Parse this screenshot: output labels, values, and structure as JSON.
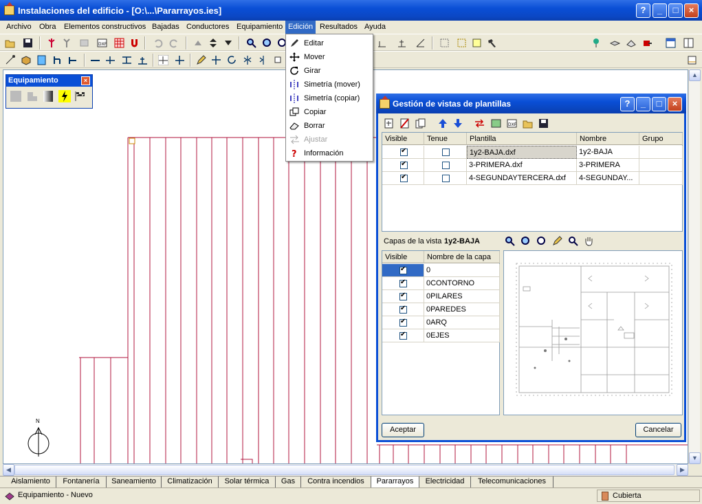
{
  "window": {
    "title": "Instalaciones del edificio - [O:\\...\\Pararrayos.ies]"
  },
  "menubar": [
    "Archivo",
    "Obra",
    "Elementos constructivos",
    "Bajadas",
    "Conductores",
    "Equipamiento",
    "Edición",
    "Resultados",
    "Ayuda"
  ],
  "edit_menu": [
    {
      "label": "Editar",
      "icon": "pencil-icon",
      "enabled": true
    },
    {
      "label": "Mover",
      "icon": "move-arrows-icon",
      "enabled": true
    },
    {
      "label": "Girar",
      "icon": "rotate-icon",
      "enabled": true
    },
    {
      "label": "Simetría (mover)",
      "icon": "mirror-move-icon",
      "enabled": true
    },
    {
      "label": "Simetría (copiar)",
      "icon": "mirror-copy-icon",
      "enabled": true
    },
    {
      "label": "Copiar",
      "icon": "copy-icon",
      "enabled": true
    },
    {
      "label": "Borrar",
      "icon": "eraser-icon",
      "enabled": true
    },
    {
      "label": "Ajustar",
      "icon": "adjust-icon",
      "enabled": false
    },
    {
      "label": "Información",
      "icon": "info-icon",
      "enabled": true
    }
  ],
  "palette": {
    "title": "Equipamiento"
  },
  "dialog": {
    "title": "Gestión de vistas de plantillas",
    "columns": [
      "Visible",
      "Tenue",
      "Plantilla",
      "Nombre",
      "Grupo"
    ],
    "rows": [
      {
        "visible": true,
        "tenue": false,
        "plantilla": "1y2-BAJA.dxf",
        "nombre": "1y2-BAJA",
        "grupo": ""
      },
      {
        "visible": true,
        "tenue": false,
        "plantilla": "3-PRIMERA.dxf",
        "nombre": "3-PRIMERA",
        "grupo": ""
      },
      {
        "visible": true,
        "tenue": false,
        "plantilla": "4-SEGUNDAYTERCERA.dxf",
        "nombre": "4-SEGUNDAY...",
        "grupo": ""
      }
    ],
    "layers_label": "Capas de la vista",
    "layers_view": "1y2-BAJA",
    "layer_columns": [
      "Visible",
      "Nombre de la capa"
    ],
    "layers": [
      {
        "visible": true,
        "name": "0"
      },
      {
        "visible": true,
        "name": "0CONTORNO"
      },
      {
        "visible": true,
        "name": "0PILARES"
      },
      {
        "visible": true,
        "name": "0PAREDES"
      },
      {
        "visible": true,
        "name": "0ARQ"
      },
      {
        "visible": true,
        "name": "0EJES"
      }
    ],
    "accept_label": "Aceptar",
    "cancel_label": "Cancelar"
  },
  "tabs": [
    "Aislamiento",
    "Fontanería",
    "Saneamiento",
    "Climatización",
    "Solar térmica",
    "Gas",
    "Contra incendios",
    "Pararrayos",
    "Electricidad",
    "Telecomunicaciones"
  ],
  "selected_tab": "Pararrayos",
  "status": {
    "left": "Equipamiento - Nuevo",
    "right": "Cubierta"
  },
  "north_label": "N",
  "colors": {
    "drawing_line": "#b0143c",
    "title_blue": "#0a4fd6",
    "selection": "#316ac5"
  }
}
